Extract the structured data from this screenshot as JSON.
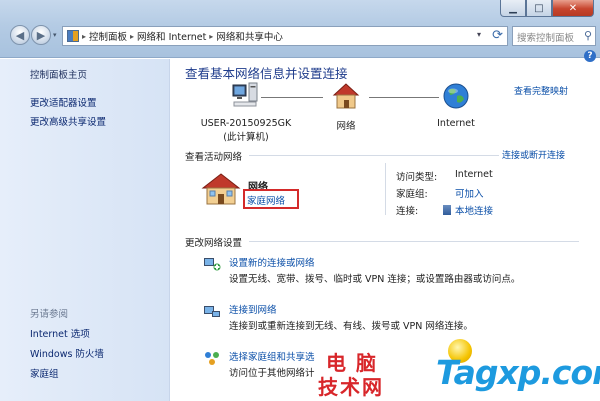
{
  "window": {
    "controls": {
      "minimize": "▁",
      "maximize": "□",
      "close": "✕"
    }
  },
  "nav": {
    "back_glyph": "◀",
    "forward_glyph": "▶",
    "history_glyph": "▾"
  },
  "address_bar": {
    "breadcrumbs": [
      "控制面板",
      "网络和 Internet",
      "网络和共享中心"
    ],
    "separator": "▸"
  },
  "search": {
    "placeholder": "搜索控制面板"
  },
  "sidebar": {
    "items": [
      {
        "label": "控制面板主页"
      },
      {
        "label": "更改适配器设置"
      },
      {
        "label": "更改高级共享设置"
      }
    ],
    "see_also_title": "另请参阅",
    "see_also": [
      {
        "label": "Internet 选项"
      },
      {
        "label": "Windows 防火墙"
      },
      {
        "label": "家庭组"
      }
    ]
  },
  "main": {
    "title": "查看基本网络信息并设置连接",
    "full_map_link": "查看完整映射",
    "map": {
      "computer_name": "USER-20150925GK",
      "computer_sub": "(此计算机)",
      "network_label": "网络",
      "internet_label": "Internet"
    },
    "active_title": "查看活动网络",
    "connect_disconnect_link": "连接或断开连接",
    "active_network": {
      "name": "网络",
      "type": "家庭网络",
      "access_type_label": "访问类型:",
      "access_type_value": "Internet",
      "homegroup_label": "家庭组:",
      "homegroup_value": "可加入",
      "connections_label": "连接:",
      "connections_value": "本地连接"
    },
    "change_title": "更改网络设置",
    "tasks": [
      {
        "link": "设置新的连接或网络",
        "desc": "设置无线、宽带、拨号、临时或 VPN 连接；或设置路由器或访问点。"
      },
      {
        "link": "连接到网络",
        "desc": "连接到或重新连接到无线、有线、拨号或 VPN 网络连接。"
      },
      {
        "link": "选择家庭组和共享选",
        "desc": "访问位于其他网络计"
      }
    ]
  },
  "watermark": {
    "cn_line1": "电脑",
    "cn_line2": "技术网",
    "en": "Tagxp.com"
  },
  "colors": {
    "link": "#0b4fa8",
    "title": "#1f3c8c",
    "sidebar_bg": "#dde8f7",
    "highlight_box": "#d42a2a",
    "watermark_red": "#d8262a",
    "watermark_blue": "#1d9adf"
  }
}
